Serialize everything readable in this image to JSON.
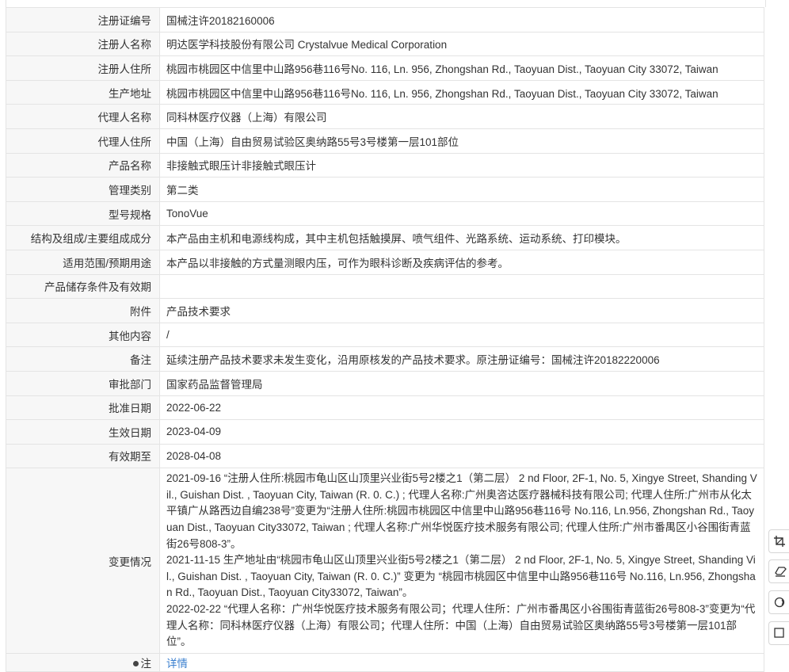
{
  "rows": [
    {
      "label": "注册证编号",
      "value": "国械注许20182160006"
    },
    {
      "label": "注册人名称",
      "value": "明达医学科技股份有限公司 Crystalvue Medical Corporation"
    },
    {
      "label": "注册人住所",
      "value": "桃园市桃园区中信里中山路956巷116号No. 116, Ln. 956, Zhongshan Rd., Taoyuan Dist., Taoyuan City 33072, Taiwan"
    },
    {
      "label": "生产地址",
      "value": "桃园市桃园区中信里中山路956巷116号No. 116, Ln. 956, Zhongshan Rd., Taoyuan Dist., Taoyuan City 33072, Taiwan"
    },
    {
      "label": "代理人名称",
      "value": "同科林医疗仪器（上海）有限公司"
    },
    {
      "label": "代理人住所",
      "value": "中国（上海）自由贸易试验区奥纳路55号3号楼第一层101部位"
    },
    {
      "label": "产品名称",
      "value": "非接触式眼压计非接触式眼压计"
    },
    {
      "label": "管理类别",
      "value": "第二类"
    },
    {
      "label": "型号规格",
      "value": "TonoVue"
    },
    {
      "label": "结构及组成/主要组成成分",
      "value": "本产品由主机和电源线构成，其中主机包括触摸屏、喷气组件、光路系统、运动系统、打印模块。"
    },
    {
      "label": "适用范围/预期用途",
      "value": "本产品以非接触的方式量测眼内压，可作为眼科诊断及疾病评估的参考。"
    },
    {
      "label": "产品储存条件及有效期",
      "value": ""
    },
    {
      "label": "附件",
      "value": "产品技术要求"
    },
    {
      "label": "其他内容",
      "value": "/"
    },
    {
      "label": "备注",
      "value": "延续注册产品技术要求未发生变化，沿用原核发的产品技术要求。原注册证编号：国械注许20182220006"
    },
    {
      "label": "审批部门",
      "value": "国家药品监督管理局"
    },
    {
      "label": "批准日期",
      "value": "2022-06-22"
    },
    {
      "label": "生效日期",
      "value": "2023-04-09"
    },
    {
      "label": "有效期至",
      "value": "2028-04-08"
    }
  ],
  "changes": {
    "label": "变更情况",
    "entries": [
      "2021-09-16 “注册人住所:桃园市龟山区山顶里兴业街5号2楼之1（第二层） 2 nd Floor, 2F-1, No. 5, Xingye Street, Shanding Vil., Guishan Dist. , Taoyuan City, Taiwan (R. 0. C.) ; 代理人名称:广州奥咨达医疗器械科技有限公司; 代理人住所:广州市从化太平镇广从路西边自编238号”变更为“注册人住所:桃园市桃园区中信里中山路956巷116号 No.116, Ln.956, Zhongshan Rd., Taoyuan Dist., Taoyuan City33072, Taiwan ; 代理人名称:广州华悦医疗技术服务有限公司; 代理人住所:广州市番禺区小谷围街青蓝街26号808-3”。",
      "2021-11-15 生产地址由“桃园市龟山区山顶里兴业街5号2楼之1（第二层） 2 nd Floor, 2F-1, No. 5, Xingye Street, Shanding Vil., Guishan Dist. , Taoyuan City, Taiwan (R. 0. C.)” 变更为 “桃园市桃园区中信里中山路956巷116号 No.116, Ln.956, Zhongshan Rd., Taoyuan Dist., Taoyuan City33072, Taiwan”。",
      "2022-02-22 “代理人名称：广州华悦医疗技术服务有限公司；代理人住所：广州市番禺区小谷围街青蓝街26号808-3”变更为“代理人名称：同科林医疗仪器（上海）有限公司；代理人住所：中国（上海）自由贸易试验区奥纳路55号3号楼第一层101部位”。"
    ]
  },
  "details": {
    "label": "注",
    "link": "详情"
  },
  "side_tools": {
    "icons": [
      "crop-icon",
      "eraser-icon",
      "circle-toggle-icon",
      "square-icon"
    ]
  },
  "colors": {
    "label_bg": "#f7f7f7",
    "border": "#e4e4e4",
    "link": "#3a7fcf"
  }
}
